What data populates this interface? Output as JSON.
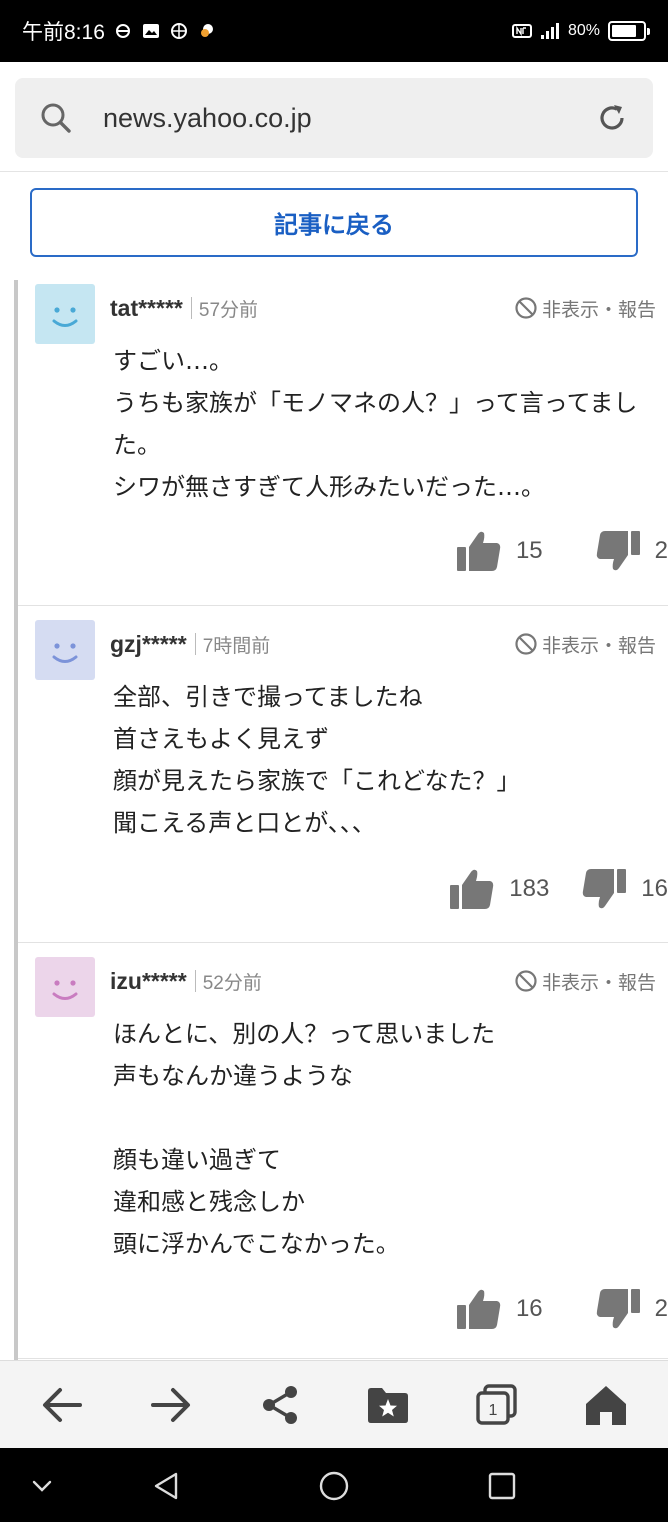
{
  "status_bar": {
    "time": "午前8:16",
    "battery_text": "80%",
    "battery_level": 0.8,
    "left_icons": [
      "data-saver-icon",
      "image-icon",
      "globe-icon",
      "weather-icon"
    ],
    "right_icons": [
      "nfc-icon",
      "signal-icon",
      "battery-icon"
    ]
  },
  "browser": {
    "url": "news.yahoo.co.jp"
  },
  "back_button": {
    "label": "記事に戻る"
  },
  "hide_report_label": "非表示・報告",
  "comments": [
    {
      "user": "tat*****",
      "time": "57分前",
      "avatar_color": "#c5e6f2",
      "face_color": "#49a9d6",
      "text": "すごい…。\nうちも家族が「モノマネの人？」って言ってました。\nシワが無さすぎて人形みたいだった…。",
      "likes": "15",
      "dislikes": "2"
    },
    {
      "user": "gzj*****",
      "time": "7時間前",
      "avatar_color": "#d5dcf2",
      "face_color": "#7c93d9",
      "text": "全部、引きで撮ってましたね\n首さえもよく見えず\n顔が見えたら家族で「これどなた？」\n聞こえる声と口とが、、、",
      "likes": "183",
      "dislikes": "16"
    },
    {
      "user": "izu*****",
      "time": "52分前",
      "avatar_color": "#ecd5ea",
      "face_color": "#c97cc0",
      "text": "ほんとに、別の人？って思いました\n声もなんか違うような\n\n顔も違い過ぎて\n違和感と残念しか\n頭に浮かんでこなかった。",
      "likes": "16",
      "dislikes": "2"
    }
  ],
  "toolbar": {
    "items": [
      "back-arrow-icon",
      "forward-arrow-icon",
      "share-icon",
      "bookmark-icon",
      "tabs-icon",
      "home-icon"
    ],
    "tab_count": "1"
  },
  "colors": {
    "accent": "#1a5fc3",
    "status_bar_bg": "#000000"
  }
}
